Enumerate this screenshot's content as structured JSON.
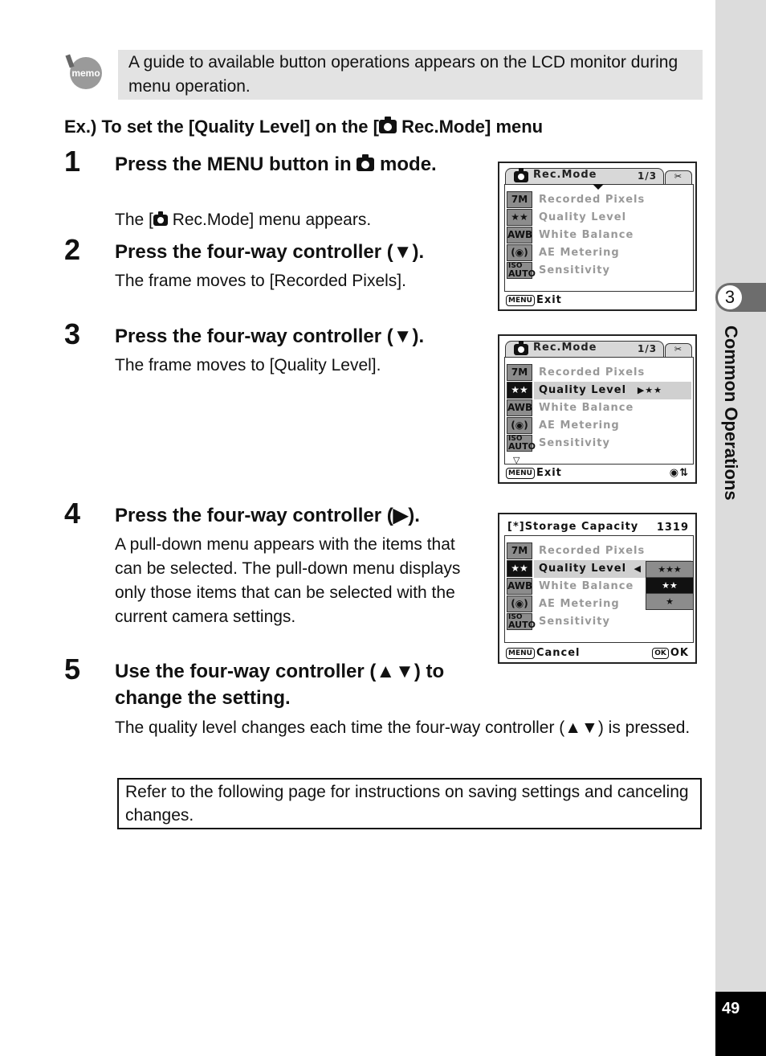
{
  "memo": {
    "icon": "memo-icon",
    "icon_label": "memo",
    "text": "A guide to available button operations appears on the LCD monitor during menu operation."
  },
  "example_title_pre": "Ex.) To set the [Quality Level] on the [",
  "example_title_post": " Rec.Mode] menu",
  "steps": [
    {
      "num": "1",
      "title_pre": "Press the MENU button in ",
      "title_post": " mode.",
      "desc_pre": "The [",
      "desc_post": " Rec.Mode] menu appears."
    },
    {
      "num": "2",
      "title": "Press the four-way controller (▼).",
      "desc": "The frame moves to [Recorded Pixels]."
    },
    {
      "num": "3",
      "title": "Press the four-way controller (▼).",
      "desc": "The frame moves to [Quality Level]."
    },
    {
      "num": "4",
      "title": "Press the four-way controller (▶).",
      "desc": "A pull-down menu appears with the items that can be selected. The pull-down menu displays only those items that can be selected with the current camera settings."
    },
    {
      "num": "5",
      "title": "Use the four-way controller (▲▼) to change the setting.",
      "desc": "The quality level changes each time the four-way controller (▲▼) is pressed."
    }
  ],
  "reference_note": "Refer to the following page for instructions on saving settings and canceling changes.",
  "lcd_menu_items": [
    "Recorded Pixels",
    "Quality Level",
    "White Balance",
    "AE Metering",
    "Sensitivity"
  ],
  "lcd_icons": [
    "7M",
    "★★",
    "AWB",
    "(◉)",
    "AUTO"
  ],
  "lcd_iso_label": "ISO",
  "lcd1": {
    "tab_title": "Rec.Mode",
    "page": "1/3",
    "setup_tab": "✂",
    "footer_key": "MENU",
    "footer_label": "Exit"
  },
  "lcd2": {
    "tab_title": "Rec.Mode",
    "page": "1/3",
    "setup_tab": "✂",
    "footer_key": "MENU",
    "footer_label": "Exit",
    "selected_value": "▶★★",
    "footer_right": "◉⇅"
  },
  "lcd3": {
    "header": "Storage Capacity",
    "capacity": "1319",
    "footer_key": "MENU",
    "footer_label": "Cancel",
    "ok_key": "OK",
    "ok_label": "OK",
    "selected_value": "◀",
    "options": [
      "★★★",
      "★★",
      "★"
    ],
    "selected_option": "★★"
  },
  "sidebar": {
    "chapter_number": "3",
    "chapter_title": "Common Operations"
  },
  "page_number": "49"
}
